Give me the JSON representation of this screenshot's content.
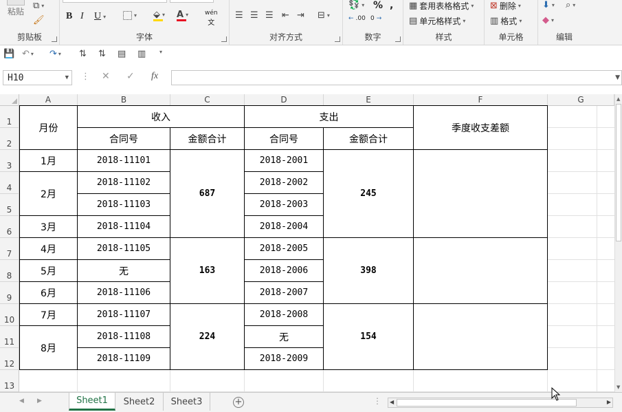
{
  "ribbon": {
    "clipboard": {
      "paste": "粘贴",
      "label": "剪贴板"
    },
    "font": {
      "bold": "B",
      "italic": "I",
      "underline": "U",
      "font_color_glyph": "A",
      "phonetic": "wén",
      "label": "字体"
    },
    "alignment": {
      "label": "对齐方式"
    },
    "number": {
      "percent": "%",
      "comma": ",",
      "inc_decimal": ".00",
      "dec_decimal": "0",
      "label": "数字"
    },
    "styles": {
      "table_format": "套用表格格式",
      "cell_styles": "单元格样式",
      "label": "样式"
    },
    "cells": {
      "delete": "删除",
      "format": "格式",
      "label": "单元格"
    },
    "editing": {
      "label": "编辑"
    },
    "colors": {
      "font_color": "#e81123",
      "fill_color": "#ffd800",
      "accent": "#217346"
    }
  },
  "formula_bar": {
    "name_box": "H10",
    "fx": "fx",
    "value": ""
  },
  "columns": [
    "A",
    "B",
    "C",
    "D",
    "E",
    "F",
    "G"
  ],
  "rows": [
    "1",
    "2",
    "3",
    "4",
    "5",
    "6",
    "7",
    "8",
    "9",
    "10",
    "11",
    "12",
    "13"
  ],
  "table": {
    "month_header": "月份",
    "income_header": "收入",
    "expense_header": "支出",
    "diff_header": "季度收支差额",
    "contract_header": "合同号",
    "amount_header": "金额合计",
    "months": [
      "1月",
      "2月",
      "3月",
      "4月",
      "5月",
      "6月",
      "7月",
      "8月"
    ],
    "income_contracts": [
      "2018-11101",
      "2018-11102",
      "2018-11103",
      "2018-11104",
      "2018-11105",
      "无",
      "2018-11106",
      "2018-11107",
      "2018-11108",
      "2018-11109"
    ],
    "income_totals": [
      "687",
      "163",
      "224"
    ],
    "expense_contracts": [
      "2018-2001",
      "2018-2002",
      "2018-2003",
      "2018-2004",
      "2018-2005",
      "2018-2006",
      "2018-2007",
      "2018-2008",
      "无",
      "2018-2009"
    ],
    "expense_totals": [
      "245",
      "398",
      "154"
    ]
  },
  "sheets": [
    "Sheet1",
    "Sheet2",
    "Sheet3"
  ],
  "active_sheet": "Sheet1"
}
